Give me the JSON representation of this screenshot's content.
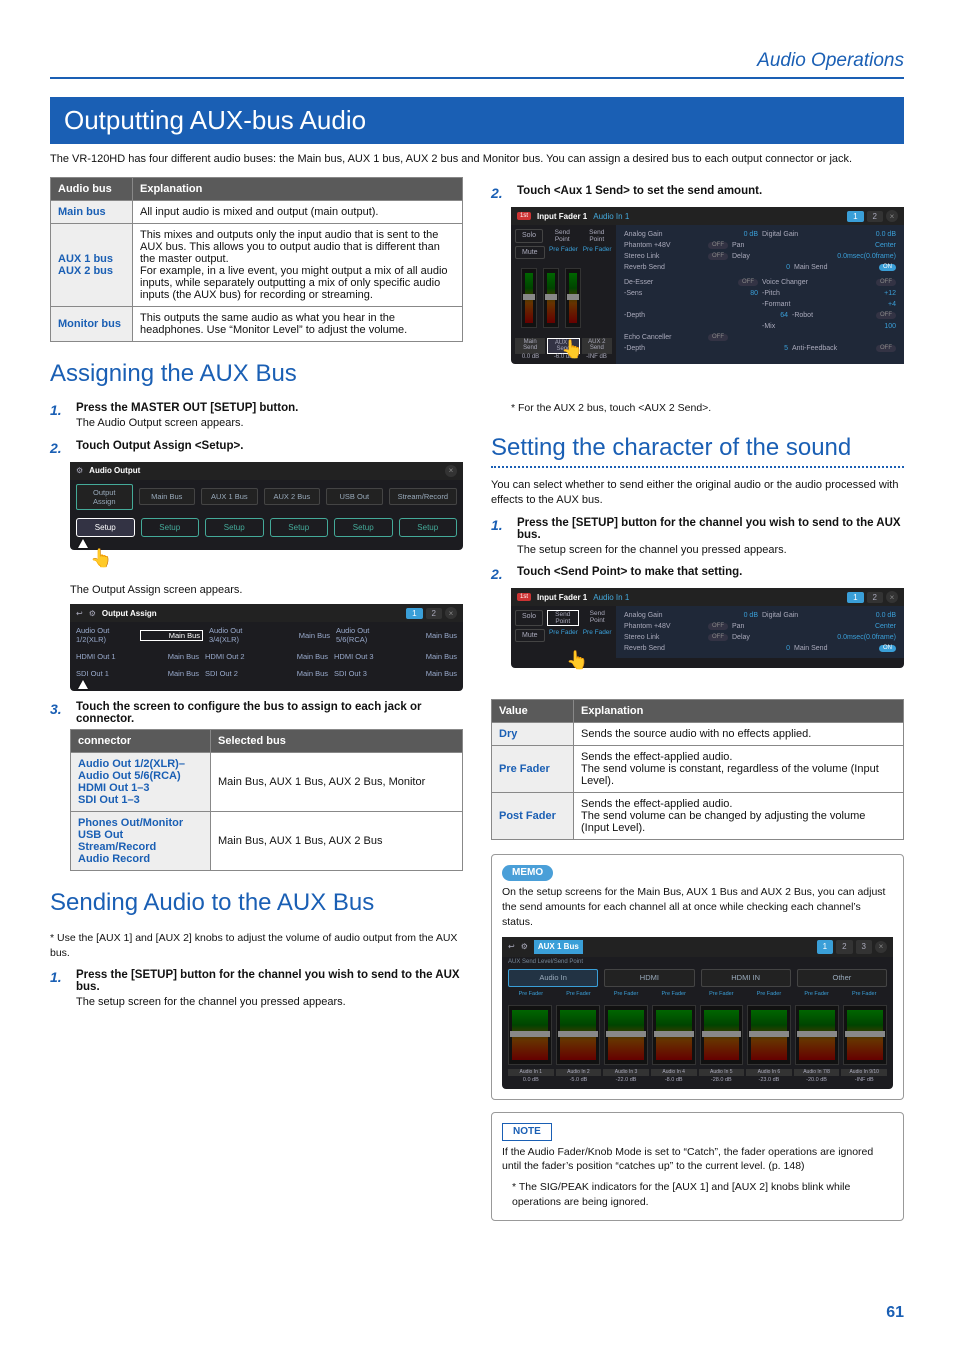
{
  "header": {
    "section": "Audio Operations"
  },
  "h1": "Outputting AUX-bus Audio",
  "intro": "The VR-120HD has four different audio buses: the Main bus, AUX 1 bus, AUX 2 bus and Monitor bus. You can assign a desired bus to each output connector or jack.",
  "busTable": {
    "headers": [
      "Audio bus",
      "Explanation"
    ],
    "rows": [
      {
        "k": "Main bus",
        "v": "All input audio is mixed and output (main output)."
      },
      {
        "k": "AUX 1 bus\nAUX 2 bus",
        "v": "This mixes and outputs only the input audio that is sent to the AUX bus. This allows you to output audio that is different than the master output.\nFor example, in a live event, you might output a mix of all audio inputs, while separately outputting a mix of only specific audio inputs (the AUX bus) for recording or streaming."
      },
      {
        "k": "Monitor bus",
        "v": "This outputs the same audio as what you hear in the headphones. Use “Monitor Level” to adjust the volume."
      }
    ]
  },
  "assignH2": "Assigning the AUX Bus",
  "assignSteps": [
    {
      "n": "1.",
      "t": "Press the MASTER OUT [SETUP] button.",
      "b": "The Audio Output screen appears."
    },
    {
      "n": "2.",
      "t": "Touch Output Assign <Setup>.",
      "b": ""
    }
  ],
  "outputAssignShot": {
    "title": "Audio Output",
    "tabs": [
      "Output Assign",
      "Main Bus",
      "AUX 1 Bus",
      "AUX 2 Bus",
      "USB Out",
      "Stream/Record"
    ],
    "btns": [
      "Setup",
      "Setup",
      "Setup",
      "Setup",
      "Setup",
      "Setup"
    ]
  },
  "outputAssignAfter": "The Output Assign screen appears.",
  "outputAssignShot2": {
    "title": "Output Assign",
    "rows": [
      [
        "Audio Out 1/2(XLR)",
        "Main Bus",
        "Audio Out 3/4(XLR)",
        "Main Bus",
        "Audio Out 5/6(RCA)",
        "Main Bus"
      ],
      [
        "HDMI Out 1",
        "Main Bus",
        "HDMI Out 2",
        "Main Bus",
        "HDMI Out 3",
        "Main Bus"
      ],
      [
        "SDI Out 1",
        "Main Bus",
        "SDI Out 2",
        "Main Bus",
        "SDI Out 3",
        "Main Bus"
      ]
    ]
  },
  "assignStep3": {
    "n": "3.",
    "t": "Touch the screen to configure the bus to assign to each jack or connector."
  },
  "connectorTable": {
    "headers": [
      "connector",
      "Selected bus"
    ],
    "rows": [
      {
        "k": "Audio Out 1/2(XLR)–\nAudio Out 5/6(RCA)\nHDMI Out 1–3\nSDI Out 1–3",
        "v": "Main Bus, AUX 1 Bus, AUX 2 Bus, Monitor"
      },
      {
        "k": "Phones Out/Monitor\nUSB Out\nStream/Record\nAudio Record",
        "v": "Main Bus, AUX 1 Bus, AUX 2 Bus"
      }
    ]
  },
  "sendH2": "Sending Audio to the AUX Bus",
  "sendNote": "Use the [AUX 1] and [AUX 2] knobs to adjust the volume of audio output from the AUX bus.",
  "sendStep1": {
    "n": "1.",
    "t": "Press the [SETUP] button for the channel you wish to send to the AUX bus.",
    "b": "The setup screen for the channel you pressed appears."
  },
  "rightStep2": {
    "n": "2.",
    "t": "Touch <Aux 1 Send> to set the send amount."
  },
  "faderShot": {
    "title": "Input Fader 1",
    "sub": "Audio In 1",
    "left": {
      "btn1": "Solo",
      "btn2": "Mute",
      "col1": "Send Point",
      "col2": "Send Point",
      "fad1": "Pre Fader",
      "fad2": "Pre Fader"
    },
    "params": [
      [
        "Analog Gain",
        "0 dB",
        "Digital Gain",
        "0.0 dB"
      ],
      [
        "Phantom +48V",
        "OFF",
        "Pan",
        "Center"
      ],
      [
        "Stereo Link",
        "OFF",
        "Delay",
        "0.0msec(0.0frame)"
      ],
      [
        "Reverb Send",
        "0",
        "Main Send",
        "ON"
      ],
      [
        "De-Esser",
        "OFF",
        "Voice Changer",
        "OFF"
      ],
      [
        "-Sens",
        "80",
        "-Pitch",
        "+12"
      ],
      [
        "",
        "",
        "-Formant",
        "+4"
      ],
      [
        "-Depth",
        "64",
        "-Robot",
        "OFF"
      ],
      [
        "",
        "",
        "-Mix",
        "100"
      ],
      [
        "Echo Canceller",
        "OFF",
        "",
        ""
      ],
      [
        "-Depth",
        "5",
        "Anti-Feedback",
        "OFF"
      ]
    ],
    "bottom": [
      "Main Send",
      "AUX 1 Send",
      "AUX 2 Send"
    ],
    "vals": [
      "0.0 dB",
      "-6.0 dB",
      "-INF dB"
    ]
  },
  "aux2note": "For the AUX 2 bus, touch <AUX 2 Send>.",
  "charH2": "Setting the character of the sound",
  "charIntro": "You can select whether to send either the original audio or the audio processed with effects to the AUX bus.",
  "charStep1": {
    "n": "1.",
    "t": "Press the [SETUP] button for the channel you wish to send to the AUX bus.",
    "b": "The setup screen for the channel you pressed appears."
  },
  "charStep2": {
    "n": "2.",
    "t": "Touch <Send Point> to make that setting."
  },
  "valueTable": {
    "headers": [
      "Value",
      "Explanation"
    ],
    "rows": [
      {
        "k": "Dry",
        "v": "Sends the source audio with no effects applied."
      },
      {
        "k": "Pre Fader",
        "v": "Sends the effect-applied audio.\nThe send volume is constant, regardless of the volume (Input Level)."
      },
      {
        "k": "Post Fader",
        "v": "Sends the effect-applied audio.\nThe send volume can be changed by adjusting the volume (Input Level)."
      }
    ]
  },
  "memo": {
    "badge": "MEMO",
    "text": "On the setup screens for the Main Bus, AUX 1 Bus and AUX 2 Bus, you can adjust the send amounts for each channel all at once while checking each channel’s status."
  },
  "memoShot": {
    "title": "AUX 1 Bus",
    "sub": "AUX Send Level/Send Point",
    "cats": [
      "Audio In",
      "HDMI",
      "HDMI IN",
      "Other"
    ],
    "labels": [
      "Pre Fader",
      "Pre Fader",
      "Pre Fader",
      "Pre Fader",
      "Pre Fader",
      "Pre Fader",
      "Pre Fader",
      "Pre Fader"
    ],
    "chs": [
      "Audio In 1",
      "Audio In 2",
      "Audio In 3",
      "Audio In 4",
      "Audio In 5",
      "Audio In 6",
      "Audio In 7/8",
      "Audio In 9/10"
    ],
    "vals": [
      "0.0 dB",
      "-5.0 dB",
      "-22.0 dB",
      "-8.0 dB",
      "-28.0 dB",
      "-23.0 dB",
      "-20.0 dB",
      "-INF dB"
    ]
  },
  "note": {
    "badge": "NOTE",
    "text": "If the Audio Fader/Knob Mode is set to “Catch”, the fader operations are ignored until the fader’s position “catches up” to the current level. (p. 148)",
    "star": "The SIG/PEAK indicators for the [AUX 1] and [AUX 2] knobs blink while operations are being ignored."
  },
  "pageNum": "61"
}
